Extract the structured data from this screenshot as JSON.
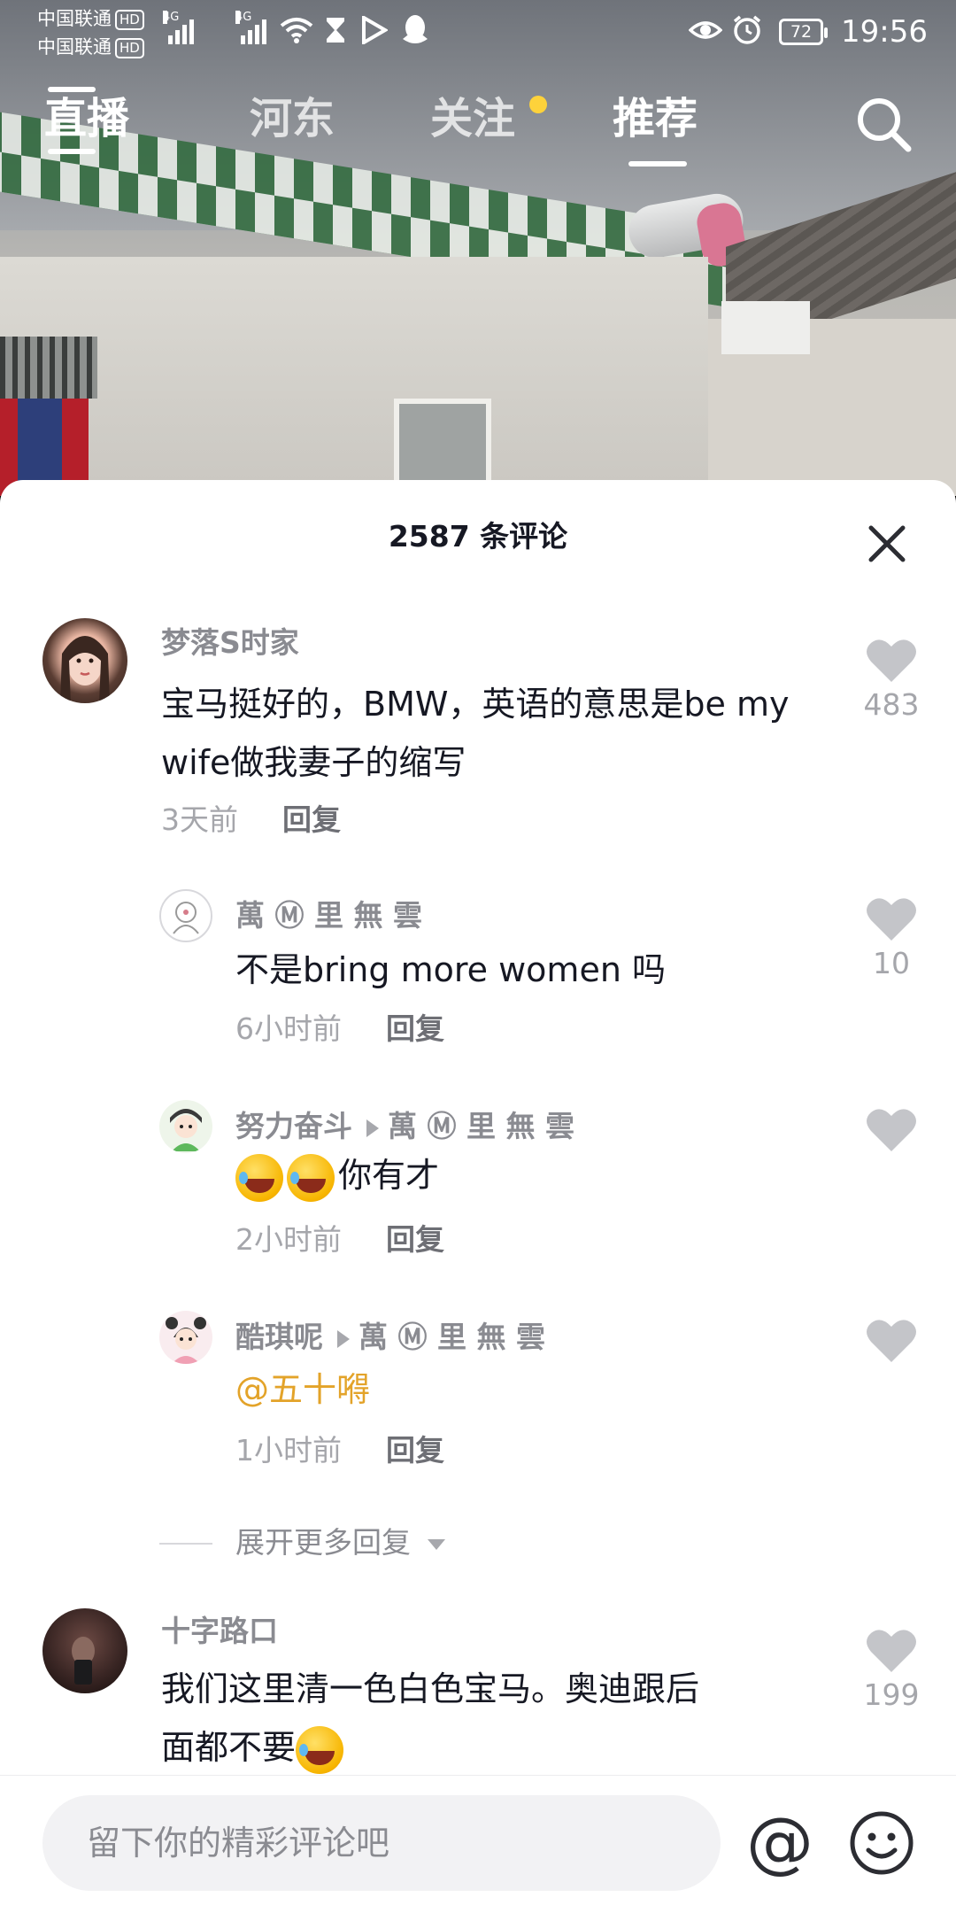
{
  "status_bar": {
    "carrier_1": "中国联通",
    "carrier_2": "中国联通",
    "hd_label": "HD",
    "network_1": "4G",
    "network_2": "4G",
    "battery": "72",
    "time": "19:56",
    "icons": [
      "wifi-icon",
      "hourglass-icon",
      "play-store-icon",
      "qq-icon",
      "eye-icon",
      "alarm-icon"
    ]
  },
  "top_nav": {
    "live": "直播",
    "tabs": [
      {
        "label": "河东",
        "active": false
      },
      {
        "label": "关注",
        "active": false,
        "has_dot": true
      },
      {
        "label": "推荐",
        "active": true
      }
    ]
  },
  "comments": {
    "title": "2587 条评论",
    "items": [
      {
        "username": "梦落S时家",
        "text": "宝马挺好的，BMW，英语的意思是be my wife做我妻子的缩写",
        "time": "3天前",
        "reply_label": "回复",
        "likes": "483",
        "replies": [
          {
            "username": "萬 Ⓜ 里 無 雲",
            "text": "不是bring more women 吗",
            "time": "6小时前",
            "reply_label": "回复",
            "likes": "10"
          },
          {
            "username": "努力奋斗",
            "reply_to": "萬 Ⓜ 里 無 雲",
            "text": "你有才",
            "time": "2小时前",
            "reply_label": "回复",
            "likes": ""
          },
          {
            "username": "酷琪呢",
            "reply_to": "萬 Ⓜ 里 無 雲",
            "text": "@五十嘚",
            "time": "1小时前",
            "reply_label": "回复",
            "likes": ""
          }
        ],
        "expand_label": "展开更多回复"
      },
      {
        "username": "十字路口",
        "text_line1": "我们这里清一色白色宝马。奥迪跟后",
        "text_line2": "面都不要",
        "likes": "199"
      }
    ]
  },
  "input": {
    "placeholder": "留下你的精彩评论吧",
    "at_symbol": "@"
  },
  "colors": {
    "accent_yellow": "#fdd23b",
    "mention": "#e3a329",
    "text_primary": "#161823",
    "text_secondary": "#8a8b91"
  }
}
